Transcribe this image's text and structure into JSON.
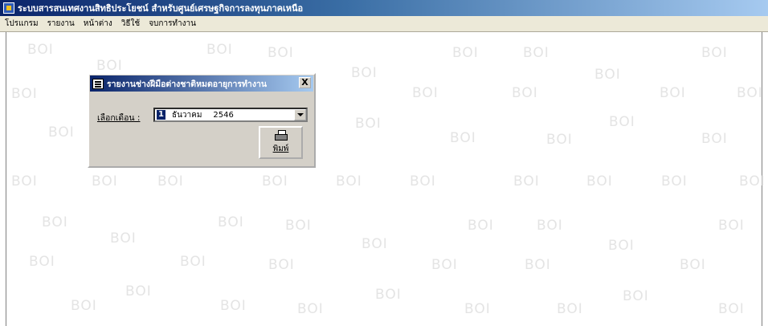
{
  "window": {
    "title": "ระบบสารสนเทศงานสิทธิประโยชน์ สำหรับศูนย์เศรษฐกิจการลงทุนภาคเหนือ"
  },
  "menu": [
    {
      "label": "โปรแกรม"
    },
    {
      "label": "รายงาน"
    },
    {
      "label": "หน้าต่าง"
    },
    {
      "label": "วิธีใช้"
    },
    {
      "label": "จบการทำงาน"
    }
  ],
  "watermark": {
    "text": "BOI"
  },
  "dialog": {
    "title": "รายงานช่างฝีมือต่างชาติหมดอายุการทำงาน",
    "close_label": "X",
    "month_label": "เลือกเดือน :",
    "month_number": "1",
    "month_name": "ธันวาคม",
    "year": "2546",
    "print_label": "พิมพ์"
  },
  "icons": {
    "app": "app-icon",
    "dialog": "report-icon",
    "print": "printer-icon"
  }
}
